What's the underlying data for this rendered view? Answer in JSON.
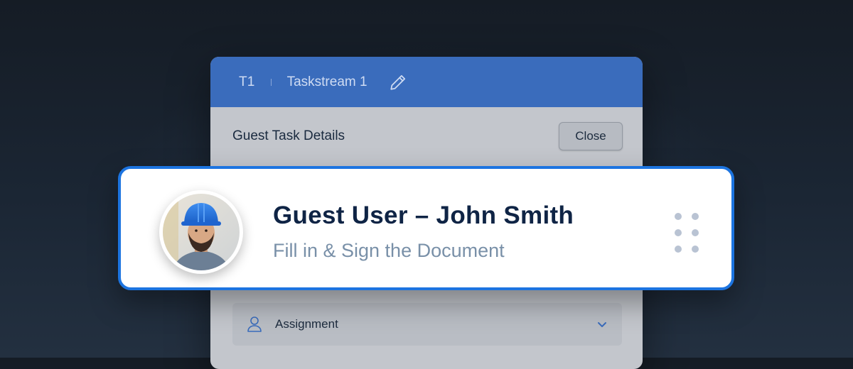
{
  "panel": {
    "header": {
      "code": "T1",
      "name": "Taskstream 1",
      "edit_icon": "pencil-icon"
    },
    "subheader": {
      "title": "Guest Task Details",
      "close_label": "Close"
    },
    "assignment": {
      "icon": "user-icon",
      "label": "Assignment",
      "chevron_icon": "chevron-down-icon"
    }
  },
  "card": {
    "title": "Guest User – John Smith",
    "subtitle": "Fill in & Sign the Document",
    "avatar_icon": "avatar",
    "drag_icon": "drag-handle-icon"
  },
  "colors": {
    "accent_blue": "#1c74e0",
    "header_blue": "#3a6cbc",
    "title_navy": "#0f2445",
    "subtitle_gray": "#7990a8"
  }
}
